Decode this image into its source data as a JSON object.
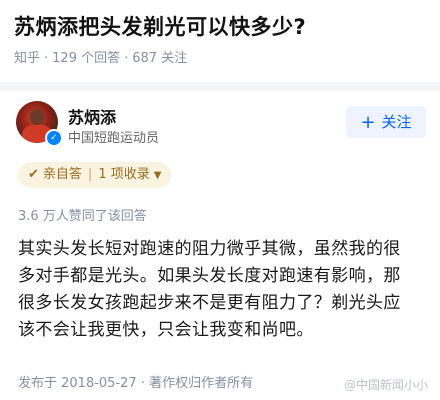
{
  "question": {
    "title": "苏炳添把头发剃光可以快多少?",
    "source": "知乎",
    "answers": "129 个回答",
    "followers": "687 关注",
    "separator": "·"
  },
  "author": {
    "name": "苏炳添",
    "description": "中国短跑运动员",
    "follow_label": "关注",
    "follow_icon": "plus-icon",
    "verified_icon": "verified-badge-icon",
    "accent_color": "#0066ff"
  },
  "tag": {
    "icon": "checkmark-circle-icon",
    "self_answer": "亲自答",
    "collections": "1 项收录",
    "chevron_icon": "chevron-down-icon"
  },
  "approve_text": "3.6 万人赞同了该回答",
  "content": "其实头发长短对跑速的阻力微乎其微，虽然我的很\n多对手都是光头。如果头发长度对跑速有影响，那\n很多长发女孩跑起步来不是更有阻力了？剃光头应\n该不会让我更快，只会让我变和尚吧。",
  "footer": "发布于 2018-05-27 · 著作权归作者所有",
  "watermark": "@中国新闻小小"
}
